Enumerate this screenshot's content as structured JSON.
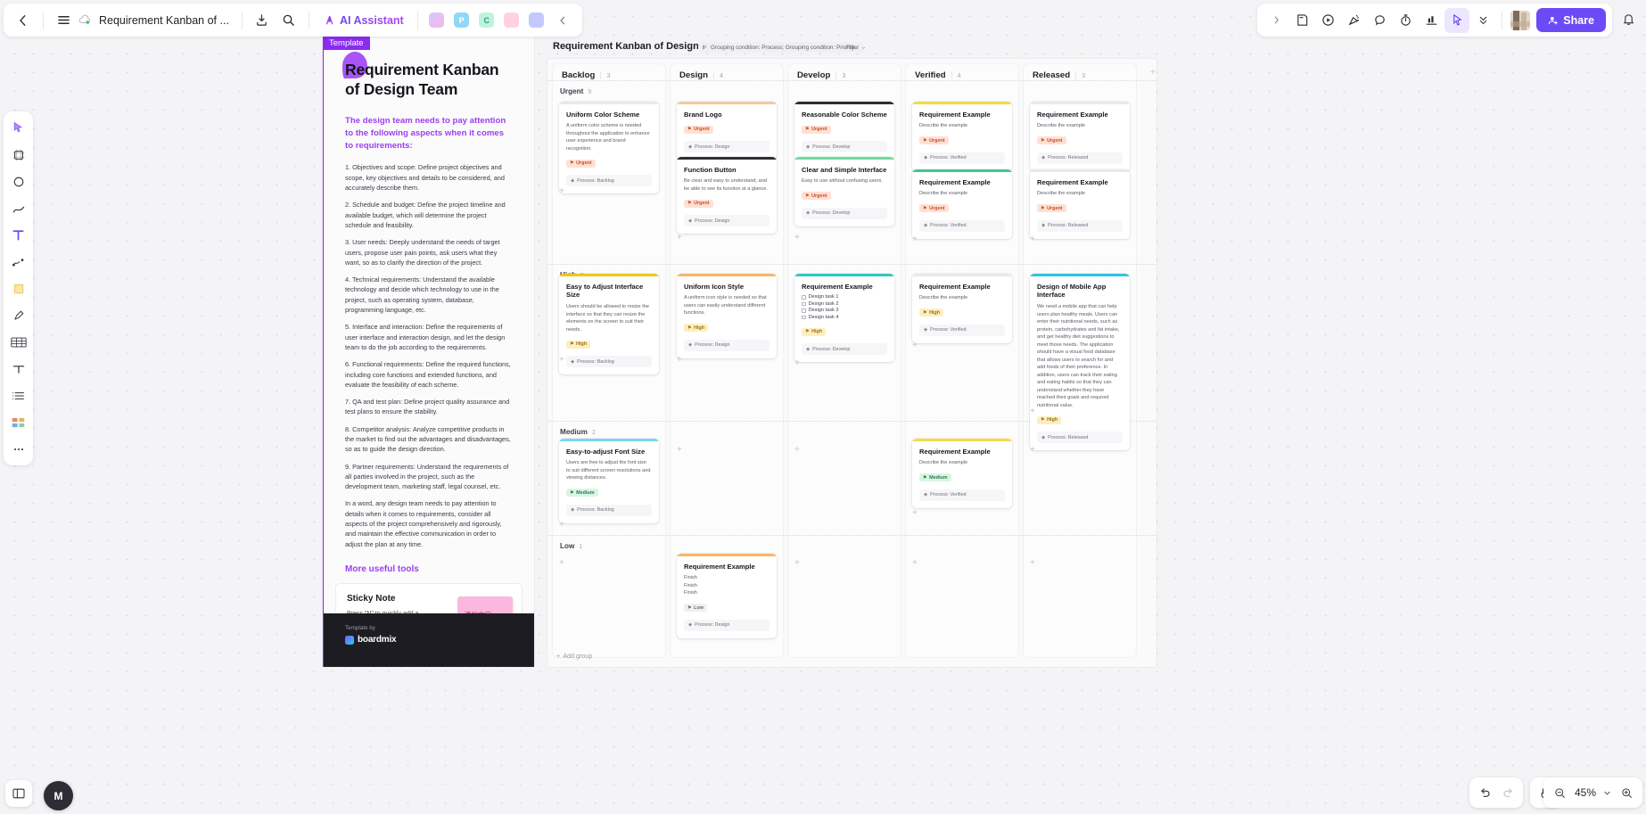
{
  "topbar": {
    "back_icon": "chevron-left-icon",
    "menu_icon": "hamburger-menu-icon",
    "cloud_icon": "cloud-saved-icon",
    "doc_title": "Requirement Kanban of ...",
    "download_icon": "download-icon",
    "search_icon": "search-icon",
    "ai_label": "AI Assistant",
    "apps": [
      {
        "name": "image-app",
        "letter": ""
      },
      {
        "name": "presentation-app",
        "letter": "P"
      },
      {
        "name": "mindmap-app",
        "letter": "C"
      },
      {
        "name": "flowchart-app",
        "letter": ""
      },
      {
        "name": "comment-app",
        "letter": ""
      }
    ],
    "collapse_icon": "chevron-left-icon"
  },
  "rightbar": {
    "expand_icon": "chevron-right-icon",
    "tools": [
      "sticky-note-icon",
      "play-circle-icon",
      "confetti-icon",
      "chat-bubble-icon",
      "timer-icon",
      "chart-icon"
    ],
    "cursor_icon": "cursor-select-icon",
    "more_icon": "chevrons-down-icon",
    "avatar_name": "avatar",
    "share_label": "Share",
    "share_icon": "person-add-icon",
    "share_color": "#6b4bf6",
    "bell_icon": "bell-icon"
  },
  "rail": {
    "items": [
      "select-pointer-icon",
      "frame-icon",
      "shape-icon",
      "pen-line-icon",
      "text-tool-icon",
      "connector-icon",
      "sticky-note-icon",
      "highlighter-icon",
      "table-icon",
      "text-box-icon",
      "list-icon",
      "template-grid-icon",
      "more-tools-icon"
    ]
  },
  "bottom": {
    "left_panel_icon": "toggle-panel-icon",
    "user_initial": "M",
    "undo_icon": "undo-icon",
    "redo_icon": "redo-icon",
    "hand_icon": "hand-tool-icon",
    "zoom_out_icon": "zoom-out-icon",
    "zoom_level": "45%",
    "zoom_caret_icon": "chevron-down-icon",
    "zoom_in_icon": "zoom-in-icon"
  },
  "template": {
    "tag": "Template",
    "title": "Requirement Kanban\nof Design Team",
    "subtitle": "The design team needs to pay attention to the following aspects when it comes to requirements:",
    "paragraphs": [
      "1. Objectives and scope: Define project objectives and scope, key objectives and details to be considered, and accurately describe them.",
      "2. Schedule and budget: Define the project timeline and available budget, which will determine the project schedule and feasibility.",
      "3. User needs: Deeply understand the needs of target users, propose user pain points, ask users what they want, so as to clarify the direction of the project.",
      "4. Technical requirements: Understand the available technology and decide which technology to use in the project, such as operating system, database, programming language, etc.",
      "5. Interface and interaction: Define the requirements of user interface and interaction design, and let the design team to do the job according to the requirements.",
      "6. Functional requirements: Define the required functions, including core functions and extended functions, and evaluate the feasibility of each scheme.",
      "7. QA and test plan: Define project quality assurance and test plans to ensure the stability.",
      "8. Competitor analysis: Analyze competitive products in the market to find out the advantages and disadvantages, so as to guide the design direction.",
      "9. Partner requirements: Understand the requirements of all parties involved in the project, such as the development team, marketing staff, legal counsel, etc.",
      "In a word, any design team needs to pay attention to details when it comes to requirements, consider all aspects of the project comprehensively and rigorously, and maintain the effective communication in order to adjust the plan at any time."
    ],
    "more_tools": "More useful tools",
    "sticky": {
      "heading": "Sticky Note",
      "body": "Press \"N\" to quickly add a sticky note to the canvas.",
      "key": "N",
      "note_text": "添加文字"
    },
    "footer": {
      "by": "Template by",
      "brand": "boardmix"
    }
  },
  "board": {
    "title": "Requirement Kanban of Design Team",
    "grouping_chip": "Grouping condition: Process; Grouping condition: Priority...",
    "grouping_icon": "group-columns-icon",
    "filter_chip": "Filter",
    "filter_icon": "chevron-down-icon",
    "add_group_label": "Add group",
    "columns": [
      {
        "name": "Backlog",
        "count": "3"
      },
      {
        "name": "Design",
        "count": "4"
      },
      {
        "name": "Develop",
        "count": "3"
      },
      {
        "name": "Verified",
        "count": "4"
      },
      {
        "name": "Released",
        "count": "3"
      }
    ],
    "groups": [
      {
        "name": "Urgent",
        "count": "9"
      },
      {
        "name": "High",
        "count": "5"
      },
      {
        "name": "Medium",
        "count": "2"
      },
      {
        "name": "Low",
        "count": "1"
      }
    ],
    "cards": [
      {
        "id": "c1",
        "col": 0,
        "group": 0,
        "bar": "#e9e9ec",
        "title": "Uniform Color Scheme",
        "desc": "A uniform color scheme is needed throughout the application to enhance user experience and brand recognition.",
        "tag": "Urgent",
        "tag_kind": "urgent",
        "process": "Process: Backlog"
      },
      {
        "id": "c2",
        "col": 1,
        "group": 0,
        "bar": "#f4c9a0",
        "title": "Brand Logo",
        "desc": "",
        "tag": "Urgent",
        "tag_kind": "urgent",
        "process": "Process: Design"
      },
      {
        "id": "c3",
        "col": 1,
        "group": 0,
        "bar": "#2f2f36",
        "title": "Function Button",
        "desc": "Be clear and easy to understand, and be able to see its function at a glance.",
        "tag": "Urgent",
        "tag_kind": "urgent",
        "process": "Process: Design"
      },
      {
        "id": "c4",
        "col": 2,
        "group": 0,
        "bar": "#2f2f36",
        "title": "Reasonable Color Scheme",
        "desc": "",
        "tag": "Urgent",
        "tag_kind": "urgent",
        "process": "Process: Develop"
      },
      {
        "id": "c5",
        "col": 2,
        "group": 0,
        "bar": "#6fdc9b",
        "title": "Clear and Simple Interface",
        "desc": "Easy to use without confusing users.",
        "tag": "Urgent",
        "tag_kind": "urgent",
        "process": "Process: Develop"
      },
      {
        "id": "c6",
        "col": 3,
        "group": 0,
        "bar": "#f5d84a",
        "title": "Requirement Example",
        "desc": "Describe the example",
        "tag": "Urgent",
        "tag_kind": "urgent",
        "process": "Process: Verified"
      },
      {
        "id": "c7",
        "col": 3,
        "group": 0,
        "bar": "#3ec98a",
        "title": "Requirement Example",
        "desc": "Describe the example",
        "tag": "Urgent",
        "tag_kind": "urgent",
        "process": "Process: Verified"
      },
      {
        "id": "c8",
        "col": 4,
        "group": 0,
        "bar": "#e9e9ec",
        "title": "Requirement Example",
        "desc": "Describe the example",
        "tag": "Urgent",
        "tag_kind": "urgent",
        "process": "Process: Released"
      },
      {
        "id": "c9",
        "col": 4,
        "group": 0,
        "bar": "#e9e9ec",
        "title": "Requirement Example",
        "desc": "Describe the example",
        "tag": "Urgent",
        "tag_kind": "urgent",
        "process": "Process: Released"
      },
      {
        "id": "c10",
        "col": 0,
        "group": 1,
        "bar": "#f5c518",
        "title": "Easy to Adjust Interface Size",
        "desc": "Users should be allowed to resize the interface so that they can resize the elements on the screen to suit their needs.",
        "tag": "High",
        "tag_kind": "high",
        "process": "Process: Backlog"
      },
      {
        "id": "c11",
        "col": 1,
        "group": 1,
        "bar": "#f8b765",
        "title": "Uniform Icon Style",
        "desc": "A uniform icon style is needed so that users can easily understand different functions.",
        "tag": "High",
        "tag_kind": "high",
        "process": "Process: Design"
      },
      {
        "id": "c12",
        "col": 2,
        "group": 1,
        "bar": "#2bc9c4",
        "title": "Requirement Example",
        "desc": "",
        "checklist": [
          "Design task 1",
          "Design task 2",
          "Design task 3",
          "Design task 4"
        ],
        "tag": "High",
        "tag_kind": "high",
        "process": "Process: Develop"
      },
      {
        "id": "c13",
        "col": 3,
        "group": 1,
        "bar": "#e9e9ec",
        "title": "Requirement Example",
        "desc": "Describe the example",
        "tag": "High",
        "tag_kind": "high",
        "process": "Process: Verified"
      },
      {
        "id": "c14",
        "col": 4,
        "group": 1,
        "bar": "#33c2e0",
        "title": "Design of Mobile App Interface",
        "desc": "We need a mobile app that can help users plan healthy meals. Users can enter their nutritional needs, such as protein, carbohydrates and fat intake, and get healthy diet suggestions to meet those needs. The application should have a visual food database that allows users to search for and add foods of their preference. In addition, users can track their eating and eating habits so that they can understand whether they have reached their goals and required nutritional value.",
        "tag": "High",
        "tag_kind": "high",
        "process": "Process: Released"
      },
      {
        "id": "c15",
        "col": 0,
        "group": 2,
        "bar": "#7dd6f0",
        "title": "Easy-to-adjust Font Size",
        "desc": "Users are free to adjust the font size to suit different screen resolutions and viewing distances.",
        "tag": "Medium",
        "tag_kind": "medium",
        "process": "Process: Backlog"
      },
      {
        "id": "c16",
        "col": 3,
        "group": 2,
        "bar": "#f5d84a",
        "title": "Requirement Example",
        "desc": "Describe the example",
        "tag": "Medium",
        "tag_kind": "medium",
        "process": "Process: Verified"
      },
      {
        "id": "c17",
        "col": 1,
        "group": 3,
        "bar": "#f8b765",
        "title": "Requirement Example",
        "desc": "Finish\nFinish\nFinish",
        "tag": "Low",
        "tag_kind": "low",
        "process": "Process: Design"
      }
    ]
  }
}
